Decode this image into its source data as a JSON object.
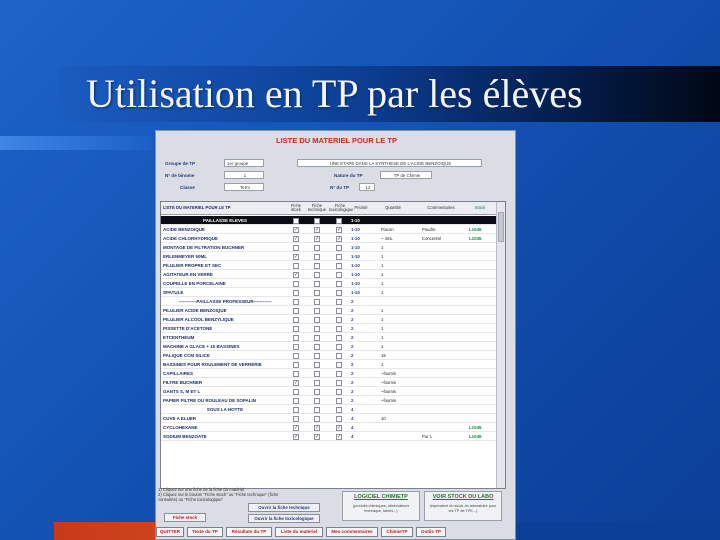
{
  "slide": {
    "title": "Utilisation en TP par les élèves"
  },
  "app": {
    "title": "LISTE DU MATERIEL POUR LE TP",
    "form": {
      "groupe_label": "Groupe de TP",
      "groupe_value": "1er groupe",
      "tp_title_value": "UNE ETAPE DANS LA SYNTHESE DE L'ACIDE BENZOIQUE",
      "binome_label": "N° de binome",
      "binome_value": "1",
      "nature_label": "Nature du TP",
      "nature_value": "TP de Chimie",
      "classe_label": "Classe",
      "classe_value": "Term",
      "notp_label": "N° du TP",
      "notp_value": "12"
    },
    "list": {
      "headers": {
        "name": "LISTE DU MATERIEL POUR LE TP",
        "stock": "Fiche stock",
        "technique": "Fiche technique",
        "toxicologique": "Fiche toxicologique",
        "priorite": "Priorité",
        "quantite": "Quantité",
        "commentaires": "Commentaires",
        "stock_lab": "Stock"
      },
      "rows": [
        {
          "name": "PAILLASSE ELEVES",
          "c1": "",
          "c2": "",
          "c3": "",
          "prio": "1-10",
          "qty": "",
          "comm": "",
          "stock": "",
          "selected": true
        },
        {
          "name": "ACIDE BENZOIQUE",
          "c1": "✓",
          "c2": "✓",
          "c3": "✓",
          "prio": "1-10",
          "qty": "Flacon",
          "comm": "Poudre",
          "stock": "L1045"
        },
        {
          "name": "ACIDE CHLORHYDRIQUE",
          "c1": "✓",
          "c2": "✓",
          "c3": "✓",
          "prio": "1-10",
          "qty": "~ 4mL",
          "comm": "Concentré",
          "stock": "L1045"
        },
        {
          "name": "MONTAGE DE FILTRATION BUCHNER",
          "c1": "",
          "c2": "",
          "c3": "",
          "prio": "1-10",
          "qty": "1",
          "comm": "",
          "stock": ""
        },
        {
          "name": "ERLENMEYER 50ML",
          "c1": "✓",
          "c2": "",
          "c3": "",
          "prio": "1-10",
          "qty": "1",
          "comm": "",
          "stock": ""
        },
        {
          "name": "PILULIER PROPRE ET SEC",
          "c1": "",
          "c2": "",
          "c3": "",
          "prio": "1-10",
          "qty": "1",
          "comm": "",
          "stock": ""
        },
        {
          "name": "AGITATEUR EN VERRE",
          "c1": "✓",
          "c2": "",
          "c3": "",
          "prio": "1-10",
          "qty": "1",
          "comm": "",
          "stock": ""
        },
        {
          "name": "COUPELLE EN PORCELAINE",
          "c1": "",
          "c2": "",
          "c3": "",
          "prio": "1-10",
          "qty": "1",
          "comm": "",
          "stock": ""
        },
        {
          "name": "SPATULE",
          "c1": "",
          "c2": "",
          "c3": "",
          "prio": "1-10",
          "qty": "1",
          "comm": "",
          "stock": ""
        },
        {
          "name": "------------PAILLASSE PROFESSEUR------------",
          "c1": "",
          "c2": "",
          "c3": "",
          "prio": "2",
          "qty": "",
          "comm": "",
          "stock": "",
          "centered": true
        },
        {
          "name": "PILULIER ACIDE BENZOIQUE",
          "c1": "",
          "c2": "",
          "c3": "",
          "prio": "2",
          "qty": "1",
          "comm": "",
          "stock": ""
        },
        {
          "name": "PILULIER ALCOOL BENZYLIQUE",
          "c1": "",
          "c2": "",
          "c3": "",
          "prio": "2",
          "qty": "1",
          "comm": "",
          "stock": ""
        },
        {
          "name": "PISSETTE D'ACETONE",
          "c1": "",
          "c2": "",
          "c3": "",
          "prio": "2",
          "qty": "1",
          "comm": "",
          "stock": ""
        },
        {
          "name": "ETCENTHEUM",
          "c1": "",
          "c2": "",
          "c3": "",
          "prio": "2",
          "qty": "1",
          "comm": "",
          "stock": ""
        },
        {
          "name": "MACHINE A GLACE + 10 BASSINES",
          "c1": "",
          "c2": "",
          "c3": "",
          "prio": "2",
          "qty": "1",
          "comm": "",
          "stock": ""
        },
        {
          "name": "PALIQUE CCM SILICE",
          "c1": "",
          "c2": "",
          "c3": "",
          "prio": "2",
          "qty": "15",
          "comm": "",
          "stock": ""
        },
        {
          "name": "BASSINES POUR ROULEMENT DE VERRERIE",
          "c1": "",
          "c2": "",
          "c3": "",
          "prio": "2",
          "qty": "1",
          "comm": "",
          "stock": ""
        },
        {
          "name": "CAPILLAIRES",
          "c1": "",
          "c2": "",
          "c3": "",
          "prio": "2",
          "qty": "~fournis",
          "comm": "",
          "stock": ""
        },
        {
          "name": "FILTRE BUCHNER",
          "c1": "✓",
          "c2": "",
          "c3": "",
          "prio": "2",
          "qty": "~fournis",
          "comm": "",
          "stock": ""
        },
        {
          "name": "GANTS S, M ET L",
          "c1": "",
          "c2": "",
          "c3": "",
          "prio": "2",
          "qty": "~fournis",
          "comm": "",
          "stock": ""
        },
        {
          "name": "PAPIER FILTRE OU ROULEAU DE SOPALIN",
          "c1": "",
          "c2": "",
          "c3": "",
          "prio": "2",
          "qty": "~fournis",
          "comm": "",
          "stock": ""
        },
        {
          "name": "SOUS LA HOTTE",
          "c1": "",
          "c2": "",
          "c3": "",
          "prio": "4",
          "qty": "",
          "comm": "",
          "stock": "",
          "centered": true
        },
        {
          "name": "CUVE A ELUER",
          "c1": "",
          "c2": "",
          "c3": "",
          "prio": "4",
          "qty": "10",
          "comm": "",
          "stock": ""
        },
        {
          "name": "CYCLOHEXANE",
          "c1": "✓",
          "c2": "✓",
          "c3": "✓",
          "prio": "4",
          "qty": "",
          "comm": "",
          "stock": "L1045"
        },
        {
          "name": "SODIUM BENZOATE",
          "c1": "✓",
          "c2": "✓",
          "c3": "✓",
          "prio": "4",
          "qty": "",
          "comm": "Pur L",
          "stock": "L1045"
        }
      ]
    },
    "instructions": {
      "line1": "1) Cliquez sur une fiche de la fiche du matériel",
      "line2": "2) Cliquez sur le bouton \"Fiche stock\" ou \"Fiche technique\" (fiche",
      "line3": "consultée) ou \"Fiche toxicologique\""
    },
    "buttons": {
      "fiche_stock": "Fiche stock",
      "ouvrir_fiche_technique": "Ouvrir la fiche technique",
      "ouvrir_fiche_toxico": "Ouvrir la fiche toxicologique"
    },
    "panels": {
      "chimie_title": "LOGICIEL CHIMIETP",
      "chimie_desc": "(produits chimiques, observations technique, tables...)",
      "stock_title": "VOIR STOCK DU LABO",
      "stock_desc": "(équivalent du stock du laboratoire pour les TP de TPE...)"
    },
    "bottom_buttons": [
      {
        "key": "quitter",
        "label": "QUITTER"
      },
      {
        "key": "texte",
        "label": "Texte du TP"
      },
      {
        "key": "resultats",
        "label": "Résultats du TP"
      },
      {
        "key": "liste",
        "label": "Liste du matériel"
      },
      {
        "key": "commentaires",
        "label": "Mes commentaires"
      },
      {
        "key": "chimietp",
        "label": "ChimieTP"
      },
      {
        "key": "outils",
        "label": "Outils TP"
      }
    ]
  },
  "colors": {
    "selected_row": "#0c0c14",
    "stock_green": "#0a8a3c",
    "title_red": "#d0281c"
  }
}
